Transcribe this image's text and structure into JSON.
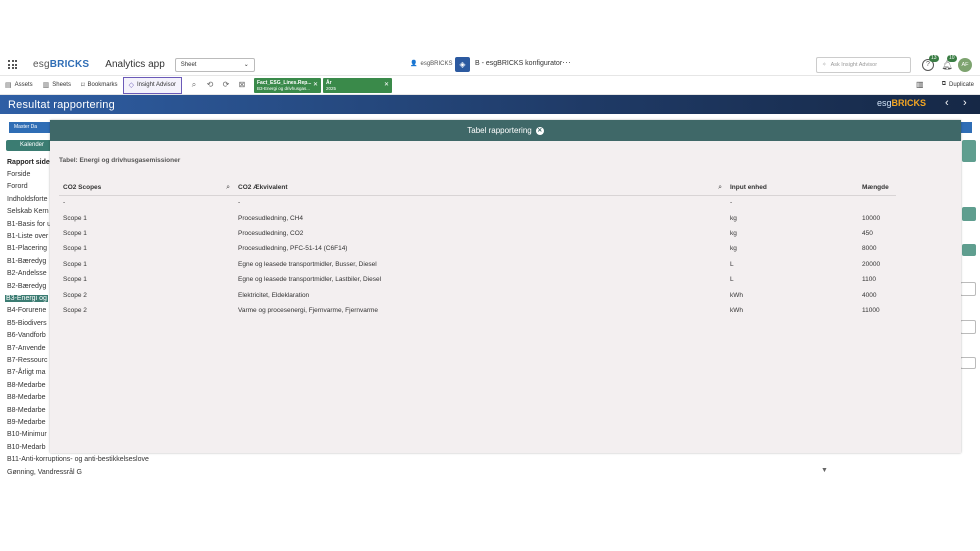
{
  "topbar": {
    "logo_prefix": "esg",
    "logo_brand": "BRICKS",
    "app_name": "Analytics app",
    "sheet_label": "Sheet",
    "user": "esgBRICKS",
    "app_title": "B - esgBRICKS konfigurator",
    "more": "···",
    "ask_placeholder": "Ask Insight Advisor",
    "help_badge": "13",
    "notif_badge": "10",
    "avatar": "AF"
  },
  "toolbar": {
    "assets": "Assets",
    "sheets": "Sheets",
    "bookmarks": "Bookmarks",
    "insight": "Insight Advisor",
    "chips": [
      {
        "title": "Fact_ESG_Lines.Rep...",
        "value": "B3-Energi og drivhusgas..."
      },
      {
        "title": "År",
        "value": "2025"
      }
    ],
    "duplicate": "Duplicate"
  },
  "band": {
    "title": "Resultat rapportering",
    "brand_prefix": "esg",
    "brand_name": "BRICKS"
  },
  "sidebar": {
    "master_btn": "Master Da",
    "kalender": "Kalender",
    "header": "Rapport side",
    "items": [
      "Forside",
      "Forord",
      "Indholdsforte",
      "Selskab Kern",
      "B1-Basis for u",
      "B1-Liste over",
      "B1-Placering",
      "B1-Bæredyg",
      "B2-Andelsse",
      "B2-Bæredyg",
      "B3-Energi og",
      "B4-Forurene",
      "B5-Biodivers",
      "B6-Vandforb",
      "B7-Anvende",
      "B7-Ressourc",
      "B7-Årligt ma",
      "B8-Medarbe",
      "B8-Medarbe",
      "B8-Medarbe",
      "B9-Medarbe",
      "B10-Minimur",
      "B10-Medarb",
      "B11-Anti-korruptions- og anti-bestikkelseslove",
      "Gønning, Vandressrål G"
    ],
    "active_index": 10
  },
  "modal": {
    "title": "Tabel rapportering",
    "table_title": "Tabel: Energi og drivhusgasemissioner",
    "columns": [
      "CO2 Scopes",
      "CO2 Ækvivalent",
      "Input enhed",
      "Mængde"
    ],
    "rows": [
      [
        "-",
        "-",
        "-",
        ""
      ],
      [
        "Scope 1",
        "Procesudledning, CH4",
        "kg",
        "10000"
      ],
      [
        "Scope 1",
        "Procesudledning, CO2",
        "kg",
        "450"
      ],
      [
        "Scope 1",
        "Procesudledning, PFC-51-14 (C6F14)",
        "kg",
        "8000"
      ],
      [
        "Scope 1",
        "Egne og leasede transportmidler, Busser, Diesel",
        "L",
        "20000"
      ],
      [
        "Scope 1",
        "Egne og leasede transportmidler, Lastbiler, Diesel",
        "L",
        "1100"
      ],
      [
        "Scope 2",
        "Elektricitet, Eldeklaration",
        "kWh",
        "4000"
      ],
      [
        "Scope 2",
        "Varme og procesenergi, Fjernvarme, Fjernvarme",
        "kWh",
        "11000"
      ]
    ]
  },
  "colors": {
    "accent_green": "#3a8a4a",
    "teal": "#3b7c72",
    "modal_header": "#3f6868",
    "band_blue": "#2f5fa5"
  }
}
